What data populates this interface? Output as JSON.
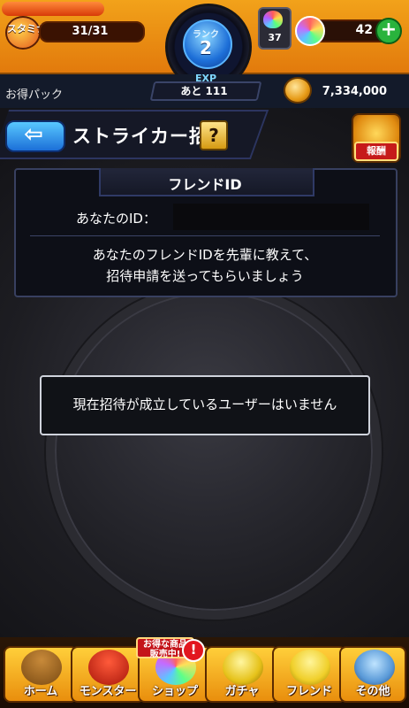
{
  "status": {
    "stamina_label": "スタミナ",
    "stamina": "31/31",
    "stamina_ratio": 1.0,
    "rank_label": "ランク",
    "rank": "2",
    "item_count": "37",
    "orb_count": "42",
    "plus": "+"
  },
  "row2": {
    "pack_label": "お得パック",
    "exp_label": "EXP",
    "exp_remaining": "あと 111",
    "gold": "7,334,000"
  },
  "header": {
    "back": "⇦",
    "title": "ストライカー招待",
    "help": "?",
    "reward": "報酬"
  },
  "friend_panel": {
    "title": "フレンドID",
    "id_label": "あなたのID：",
    "desc_line1": "あなたのフレンドIDを先輩に教えて、",
    "desc_line2": "招待申請を送ってもらいましょう"
  },
  "message": "現在招待が成立しているユーザーはいません",
  "nav": {
    "items": [
      {
        "label": "ホーム"
      },
      {
        "label": "モンスター"
      },
      {
        "label": "ショップ"
      },
      {
        "label": "ガチャ"
      },
      {
        "label": "フレンド"
      },
      {
        "label": "その他"
      }
    ],
    "shop_badge_line1": "お得な商品",
    "shop_badge_line2": "販売中!",
    "shop_alert": "!"
  }
}
